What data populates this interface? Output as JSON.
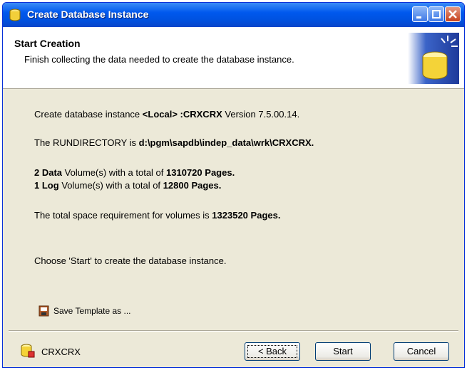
{
  "window": {
    "title": "Create Database Instance"
  },
  "header": {
    "title": "Start Creation",
    "subtitle": "Finish collecting the data needed to create the database instance."
  },
  "content": {
    "line1_prefix": "Create database instance",
    "line1_instance": "<Local> :CRXCRX",
    "line1_suffix": "Version 7.5.00.14.",
    "line2_prefix": "The RUNDIRECTORY is",
    "line2_path": "d:\\pgm\\sapdb\\indep_data\\wrk\\CRXCRX.",
    "line3_count": "2",
    "line3_kind": "Data",
    "line3_mid": "Volume(s) with a total of",
    "line3_pages": "1310720",
    "line3_unit": "Pages.",
    "line4_count": "1",
    "line4_kind": "Log",
    "line4_mid": "Volume(s) with a total of",
    "line4_pages": "12800",
    "line4_unit": "Pages.",
    "line5_prefix": "The total space requirement for volumes is",
    "line5_pages": "1323520",
    "line5_unit": "Pages.",
    "line6": "Choose 'Start' to create  the database instance.",
    "save_template_label": "Save Template as ..."
  },
  "footer": {
    "db_name": "CRXCRX",
    "back_label": "< Back",
    "start_label": "Start",
    "cancel_label": "Cancel"
  },
  "icons": {
    "app": "database-icon",
    "header": "database-sparkle-icon",
    "save": "save-template-icon",
    "footer": "database-lock-icon"
  },
  "colors": {
    "titlebar": "#0058EE",
    "dialog_bg": "#ECE9D8",
    "header_bg": "#FFFFFF",
    "button_border": "#003C74"
  }
}
